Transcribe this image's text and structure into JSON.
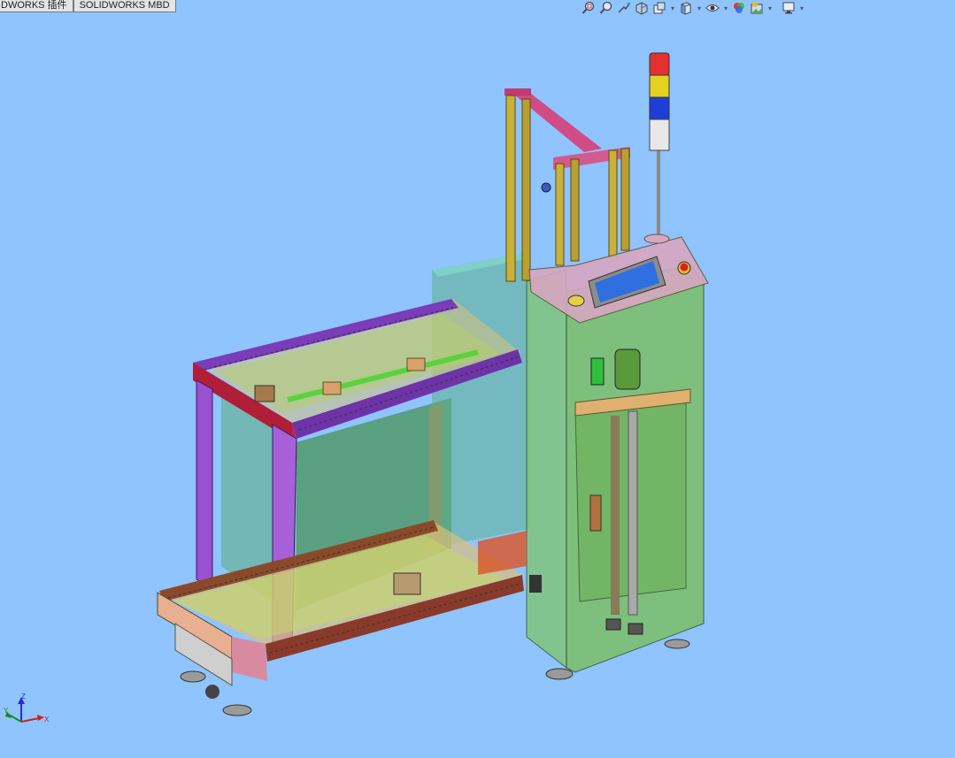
{
  "app": {
    "tabs": [
      "DWORKS 插件",
      "SOLIDWORKS MBD"
    ]
  },
  "toolbar": {
    "buttons": [
      {
        "icon": "zoom-to-fit-icon"
      },
      {
        "icon": "zoom-to-area-icon"
      },
      {
        "icon": "previous-view-icon"
      },
      {
        "icon": "section-view-icon"
      },
      {
        "icon": "dynamic-annotation-icon"
      },
      {
        "icon": "view-orientation-icon"
      },
      {
        "icon": "display-style-icon"
      },
      {
        "icon": "hide-show-items-icon"
      },
      {
        "icon": "edit-appearance-icon"
      },
      {
        "icon": "apply-scene-icon"
      },
      {
        "icon": "view-settings-icon"
      }
    ]
  },
  "triad": {
    "x_label": "X",
    "y_label": "Y",
    "z_label": "Z"
  },
  "colors": {
    "background": "#8fc4ff",
    "frame_purple": "#8a3fbf",
    "frame_red": "#c0263f",
    "frame_magenta": "#d04c86",
    "glass_green": "#6fbf5a",
    "screen_blue": "#2f6fe0"
  }
}
